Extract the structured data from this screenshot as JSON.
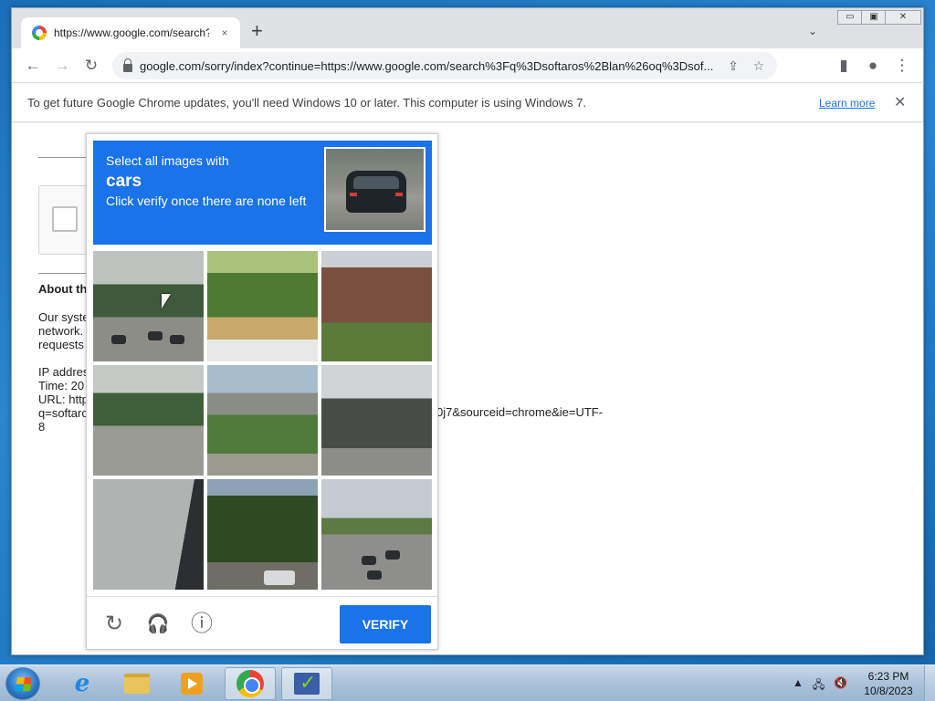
{
  "browser": {
    "tab_title": "https://www.google.com/search?",
    "tab_close": "×",
    "new_tab": "+",
    "tab_search": "⌄",
    "window_min": "▭",
    "window_max": "▣",
    "window_close": "✕",
    "back": "←",
    "forward": "→",
    "reload": "↻",
    "url": "google.com/sorry/index?continue=https://www.google.com/search%3Fq%3Dsoftaros%2Blan%26oq%3Dsof...",
    "share": "⇪",
    "bookmark": "☆",
    "side_panel": "▮",
    "profile": "●",
    "menu": "⋮"
  },
  "infobar": {
    "message": "To get future Google Chrome updates, you'll need Windows 10 or later. This computer is using Windows 7.",
    "link": "Learn more",
    "close": "✕"
  },
  "page": {
    "about_heading": "About th",
    "para1": [
      "Our syste",
      "network.",
      "requests"
    ],
    "para2": [
      "IP addres",
      "Time: 20",
      "URL: http",
      "q=softarc",
      "8"
    ],
    "url_tail": "0j7&sourceid=chrome&ie=UTF-"
  },
  "captcha": {
    "instruction_line1": "Select all images with",
    "target": "cars",
    "instruction_line3": "Click verify once there are none left",
    "reload_icon": "↻",
    "audio_icon": "🎧",
    "info_icon": "ⓘ",
    "verify_label": "VERIFY",
    "tiles": [
      "trees-street-cars",
      "palm-tree-fence",
      "brick-house",
      "street-trees",
      "highway-overpass",
      "building-street",
      "wall-corner",
      "trees-parked-car",
      "road-with-cars"
    ]
  },
  "taskbar": {
    "clock_time": "6:23 PM",
    "clock_date": "10/8/2023",
    "tray_arrow": "▲",
    "tray_network": "🖧",
    "tray_volume": "🔇"
  },
  "colors": {
    "accent": "#1a73e8",
    "desktop": "#1f78c2"
  }
}
